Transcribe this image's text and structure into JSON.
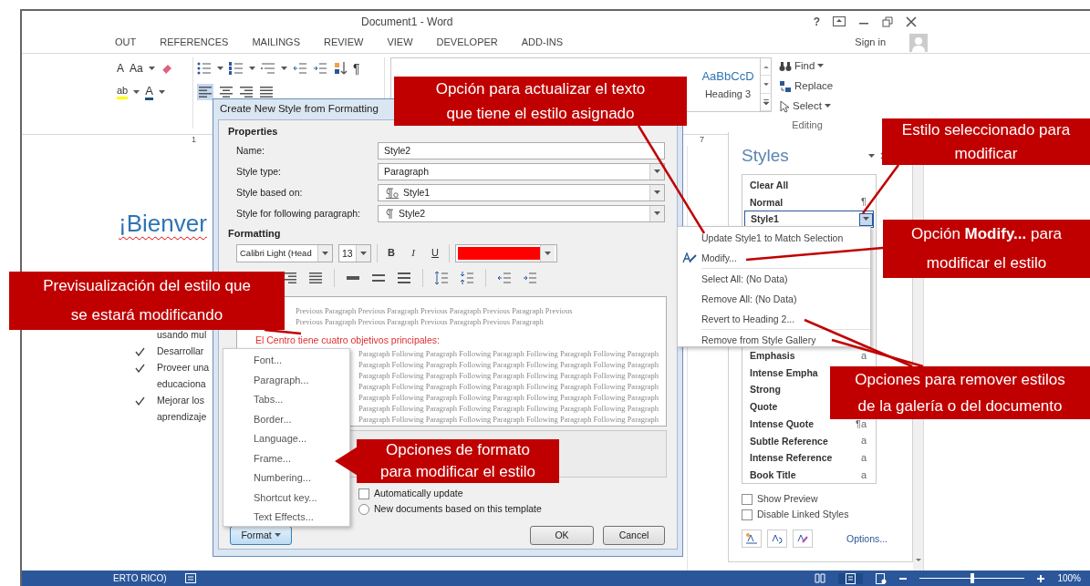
{
  "window": {
    "title": "Document1 - Word",
    "help": "?",
    "sign_in": "Sign in"
  },
  "ribbon": {
    "tabs": [
      {
        "label": "OUT",
        "selected": false
      },
      {
        "label": "REFERENCES",
        "selected": false
      },
      {
        "label": "MAILINGS",
        "selected": false
      },
      {
        "label": "REVIEW",
        "selected": false
      },
      {
        "label": "VIEW",
        "selected": false
      },
      {
        "label": "DEVELOPER",
        "selected": false
      },
      {
        "label": "ADD-INS",
        "selected": false
      }
    ],
    "grow_font": "A",
    "change_case": "Aa",
    "highlight": "ab",
    "font_color": "A",
    "pilcrow": "¶",
    "gallery": [
      {
        "sample": "AaBbCcD",
        "name": "Heading 3"
      }
    ],
    "editing": [
      {
        "label": "Find",
        "kind": "dropdown"
      },
      {
        "label": "Replace",
        "kind": "plain"
      },
      {
        "label": "Select",
        "kind": "dropdown"
      }
    ],
    "editing_label": "Editing"
  },
  "ruler": [
    "1",
    "7"
  ],
  "document": {
    "heading": "¡Bienver",
    "lines": [
      {
        "text": "usando mul",
        "kind": "continuation"
      },
      {
        "text": "Desarrollar",
        "kind": "bullet"
      },
      {
        "text": "Proveer una",
        "kind": "bullet"
      },
      {
        "text": "educaciona",
        "kind": "continuation"
      },
      {
        "text": "Mejorar los",
        "kind": "bullet"
      },
      {
        "text": "aprendizaje",
        "kind": "continuation"
      }
    ]
  },
  "status_bar": {
    "language": "ERTO RICO)",
    "zoom": "100%",
    "level": 0.5
  },
  "dialog": {
    "title": "Create New Style from Formatting",
    "properties_label": "Properties",
    "fields": [
      {
        "label": "Name:",
        "value": "Style2",
        "kind": "text"
      },
      {
        "label": "Style type:",
        "value": "Paragraph",
        "kind": "select"
      },
      {
        "label": "Style based on:",
        "value": "Style1",
        "kind": "linked-style-select"
      },
      {
        "label": "Style for following paragraph:",
        "value": "Style2",
        "kind": "paragraph-style-select"
      }
    ],
    "formatting_label": "Formatting",
    "font": "Calibri Light (Head",
    "size": "13",
    "bold": "B",
    "italic": "I",
    "underline": "U",
    "font_color": {
      "color": "#ff0000"
    },
    "preview": {
      "previous": [
        "Previous Paragraph Previous Paragraph Previous Paragraph Previous Paragraph Previous",
        "Previous Paragraph Previous Paragraph Previous Paragraph Previous Paragraph"
      ],
      "sample": "El Centro tiene cuatro objetivos principales:",
      "following": [
        "Paragraph Following Paragraph Following Paragraph Following Paragraph Following Paragraph",
        "Paragraph Following Paragraph Following Paragraph Following Paragraph Following Paragraph",
        "Paragraph Following Paragraph Following Paragraph Following Paragraph Following Paragraph",
        "Paragraph Following Paragraph Following Paragraph Following Paragraph Following Paragraph",
        "Paragraph Following Paragraph Following Paragraph Following Paragraph Following Paragraph",
        "Paragraph Following Paragraph Following Paragraph Following Paragraph Following Paragraph",
        "Paragraph Following Paragraph Following Paragraph Following Paragraph Following Paragraph"
      ]
    },
    "options": [
      {
        "label": "Automatically update",
        "kind": "checkbox",
        "checked": false
      },
      {
        "label": "New documents based on this template",
        "kind": "radio",
        "checked": false
      }
    ],
    "format_button": "Format",
    "ok": "OK",
    "cancel": "Cancel"
  },
  "format_menu": [
    "Font...",
    "Paragraph...",
    "Tabs...",
    "Border...",
    "Language...",
    "Frame...",
    "Numbering...",
    "Shortcut key...",
    "Text Effects..."
  ],
  "context_menu": [
    {
      "label": "Update Style1 to Match Selection",
      "kind": "item"
    },
    {
      "label": "Modify...",
      "kind": "icon-item"
    },
    {
      "kind": "separator"
    },
    {
      "label": "Select All: (No Data)",
      "kind": "item"
    },
    {
      "label": "Remove All: (No Data)",
      "kind": "item"
    },
    {
      "label": "Revert to Heading 2...",
      "kind": "item"
    },
    {
      "kind": "separator"
    },
    {
      "label": "Remove from Style Gallery",
      "kind": "item"
    }
  ],
  "styles_pane": {
    "title": "Styles",
    "items": [
      {
        "label": "Clear All",
        "selected": false
      },
      {
        "label": "Normal",
        "marker": "¶",
        "selected": false
      },
      {
        "label": "Style1",
        "selected": true
      },
      {
        "kind": "hidden-gap"
      },
      {
        "label": "Emphasis",
        "marker": "a",
        "selected": false
      },
      {
        "label": "Intense Empha",
        "selected": false
      },
      {
        "label": "Strong",
        "selected": false
      },
      {
        "label": "Quote",
        "selected": false
      },
      {
        "label": "Intense Quote",
        "marker": "¶a",
        "selected": false
      },
      {
        "label": "Subtle Reference",
        "marker": "a",
        "selected": false
      },
      {
        "label": "Intense Reference",
        "marker": "a",
        "selected": false
      },
      {
        "label": "Book Title",
        "marker": "a",
        "selected": false
      }
    ],
    "checkboxes": [
      {
        "label": "Show Preview",
        "checked": false
      },
      {
        "label": "Disable Linked Styles",
        "checked": false
      }
    ],
    "options_link": "Options..."
  },
  "callouts": [
    {
      "lines": [
        "Opción para actualizar el texto",
        "que tiene el estilo asignado"
      ],
      "kind": "box"
    },
    {
      "lines": [
        "Estilo seleccionado para",
        "modificar"
      ],
      "kind": "box"
    },
    {
      "lines": [
        "Opción **Modify...** para",
        "modificar el estilo"
      ],
      "kind": "box"
    },
    {
      "lines": [
        "Previsualización del estilo que",
        "se estará modificando"
      ],
      "kind": "box"
    },
    {
      "lines": [
        "Opciones de formato",
        "para modificar el estilo"
      ],
      "kind": "arrow-left"
    },
    {
      "lines": [
        "Opciones para remover estilos",
        "de la galería o del documento"
      ],
      "kind": "box"
    }
  ]
}
